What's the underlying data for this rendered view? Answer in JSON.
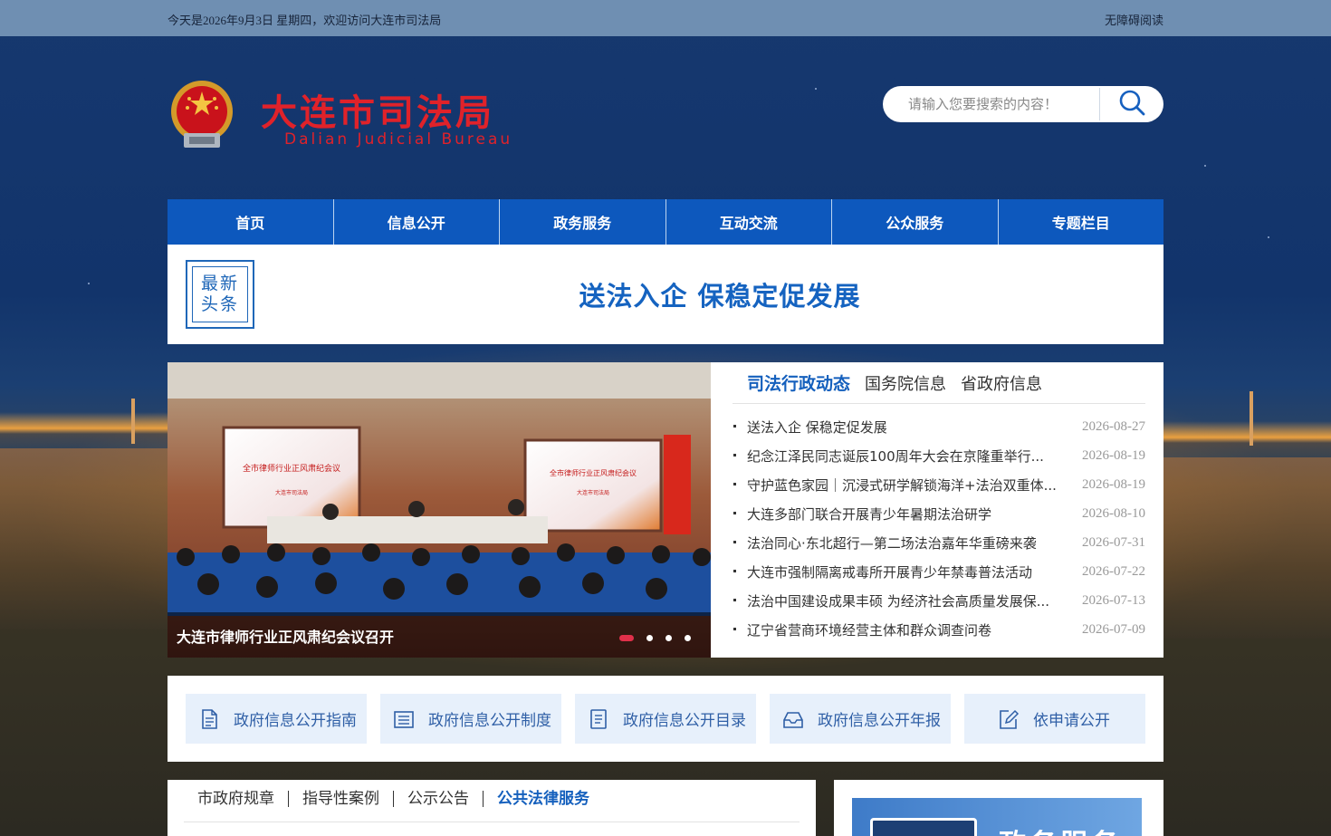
{
  "topbar": {
    "date_text": "今天是2026年9月3日 星期四，欢迎访问大连市司法局",
    "accessibility": "无障碍阅读"
  },
  "header": {
    "title": "大连市司法局",
    "subtitle": "Dalian Judicial Bureau",
    "search_placeholder": "请输入您要搜索的内容！"
  },
  "nav": [
    "首页",
    "信息公开",
    "政务服务",
    "互动交流",
    "公众服务",
    "专题栏目"
  ],
  "headline": {
    "badge_line1": "最新",
    "badge_line2": "头条",
    "text": "送法入企 保稳定促发展"
  },
  "slider": {
    "caption": "大连市律师行业正风肃纪会议召开",
    "banner_line1": "全市律师行业正风肃纪会议",
    "banner_line2": "大连市司法局",
    "dot_count": 4,
    "active_index": 0
  },
  "news": {
    "tabs": [
      "司法行政动态",
      "国务院信息",
      "省政府信息"
    ],
    "active_tab": 0,
    "items": [
      {
        "title": "送法入企 保稳定促发展",
        "date": "2026-08-27"
      },
      {
        "title": "纪念江泽民同志诞辰100周年大会在京隆重举行...",
        "date": "2026-08-19"
      },
      {
        "title": "守护蓝色家园｜沉浸式研学解锁海洋+法治双重体...",
        "date": "2026-08-19"
      },
      {
        "title": "大连多部门联合开展青少年暑期法治研学",
        "date": "2026-08-10"
      },
      {
        "title": "法治同心·东北超行—第二场法治嘉年华重磅来袭",
        "date": "2026-07-31"
      },
      {
        "title": "大连市强制隔离戒毒所开展青少年禁毒普法活动",
        "date": "2026-07-22"
      },
      {
        "title": "法治中国建设成果丰硕 为经济社会高质量发展保...",
        "date": "2026-07-13"
      },
      {
        "title": "辽宁省营商环境经营主体和群众调查问卷",
        "date": "2026-07-09"
      }
    ]
  },
  "info_links": [
    {
      "label": "政府信息公开指南",
      "icon": "guide-doc-icon"
    },
    {
      "label": "政府信息公开制度",
      "icon": "list-doc-icon"
    },
    {
      "label": "政府信息公开目录",
      "icon": "catalog-doc-icon"
    },
    {
      "label": "政府信息公开年报",
      "icon": "report-tray-icon"
    },
    {
      "label": "依申请公开",
      "icon": "edit-apply-icon"
    }
  ],
  "bottom": {
    "tabs": [
      "市政府规章",
      "指导性案例",
      "公示公告",
      "公共法律服务"
    ],
    "active_tab": 3,
    "gov_service_text": "政务服务"
  },
  "colors": {
    "nav_blue": "#0d58bd",
    "headline_blue": "#1563c0",
    "title_red": "#e0222a",
    "dot_active": "#e0304a"
  }
}
